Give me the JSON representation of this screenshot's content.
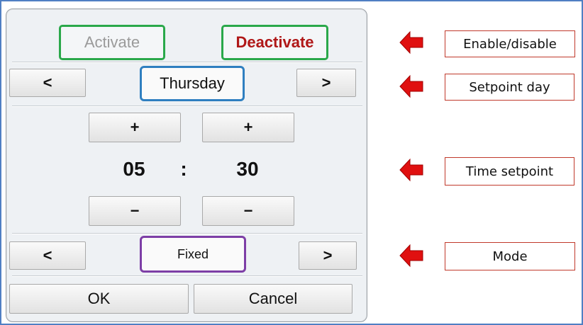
{
  "dialog": {
    "activate_label": "Activate",
    "deactivate_label": "Deactivate",
    "day_prev": "<",
    "day": "Thursday",
    "day_next": ">",
    "hour_plus": "+",
    "minute_plus": "+",
    "hour": "05",
    "separator": ":",
    "minute": "30",
    "hour_minus": "−",
    "minute_minus": "−",
    "mode_prev": "<",
    "mode": "Fixed",
    "mode_next": ">",
    "ok_label": "OK",
    "cancel_label": "Cancel"
  },
  "annotations": [
    {
      "label": "Enable/disable"
    },
    {
      "label": "Setpoint day"
    },
    {
      "label": "Time setpoint"
    },
    {
      "label": "Mode"
    }
  ],
  "colors": {
    "activate_border": "#2aa84a",
    "deactivate_text": "#b01818",
    "day_border": "#2f7fc0",
    "mode_border": "#7d3ea6",
    "arrow": "#e01010",
    "label_border": "#c0392b",
    "frame_border": "#4f7fc3"
  }
}
